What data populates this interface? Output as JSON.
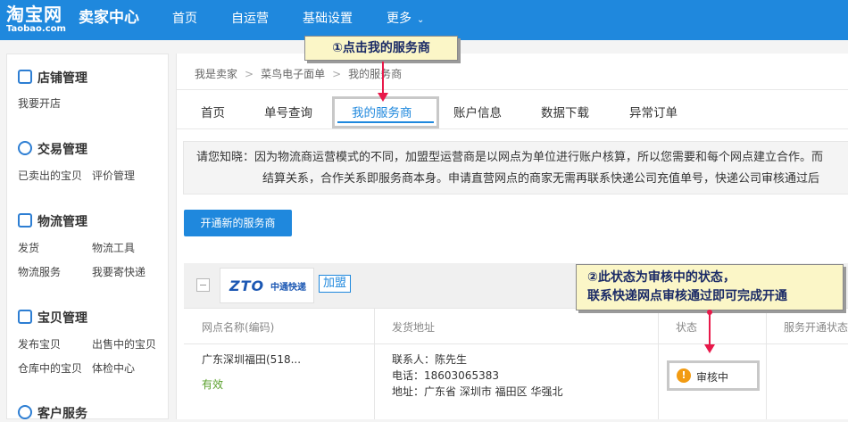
{
  "topbar": {
    "logo_cn": "淘宝网",
    "logo_en": "Taobao.com",
    "brand": "卖家中心",
    "nav": [
      "首页",
      "自运营",
      "基础设置",
      "更多"
    ]
  },
  "sidebar": {
    "sections": [
      {
        "title": "店铺管理",
        "items": [
          "我要开店"
        ]
      },
      {
        "title": "交易管理",
        "items": [
          "已卖出的宝贝",
          "评价管理"
        ]
      },
      {
        "title": "物流管理",
        "items": [
          "发货",
          "物流工具",
          "物流服务",
          "我要寄快递"
        ]
      },
      {
        "title": "宝贝管理",
        "items": [
          "发布宝贝",
          "出售中的宝贝",
          "仓库中的宝贝",
          "体检中心"
        ]
      },
      {
        "title": "客户服务",
        "items": []
      }
    ]
  },
  "breadcrumb": [
    "我是卖家",
    "菜鸟电子面单",
    "我的服务商"
  ],
  "tabs": [
    "首页",
    "单号查询",
    "我的服务商",
    "账户信息",
    "数据下载",
    "异常订单"
  ],
  "notice": {
    "line1": "请您知晓：因为物流商运营模式的不同，加盟型运营商是以网点为单位进行账户核算，所以您需要和每个网点建立合作。而",
    "line2": "结算关系，合作关系即服务商本身。申请直营网点的商家无需再联系快递公司充值单号，快递公司审核通过后"
  },
  "button_new": "开通新的服务商",
  "provider": {
    "logo_text": "ZTO",
    "logo_cn": "中通快递",
    "join": "加盟"
  },
  "columns": [
    "网点名称(编码)",
    "发货地址",
    "状态",
    "服务开通状态"
  ],
  "row": {
    "name": "广东深圳福田(518...",
    "valid": "有效",
    "contact": "联系人：陈先生",
    "phone": "电话：18603065383",
    "address": "地址：广东省 深圳市 福田区 华强北",
    "status": "审核中"
  },
  "callouts": {
    "one": "①点击我的服务商",
    "two_line1": "②此状态为审核中的状态，",
    "two_line2": "联系快递网点审核通过即可完成开通"
  },
  "colors": {
    "topbar": "#1f88dd",
    "accent": "#1f88dd",
    "arrow": "#e8194a",
    "warning": "#f29b12",
    "valid": "#5aa02c",
    "callout_bg": "#fbf6c7"
  }
}
